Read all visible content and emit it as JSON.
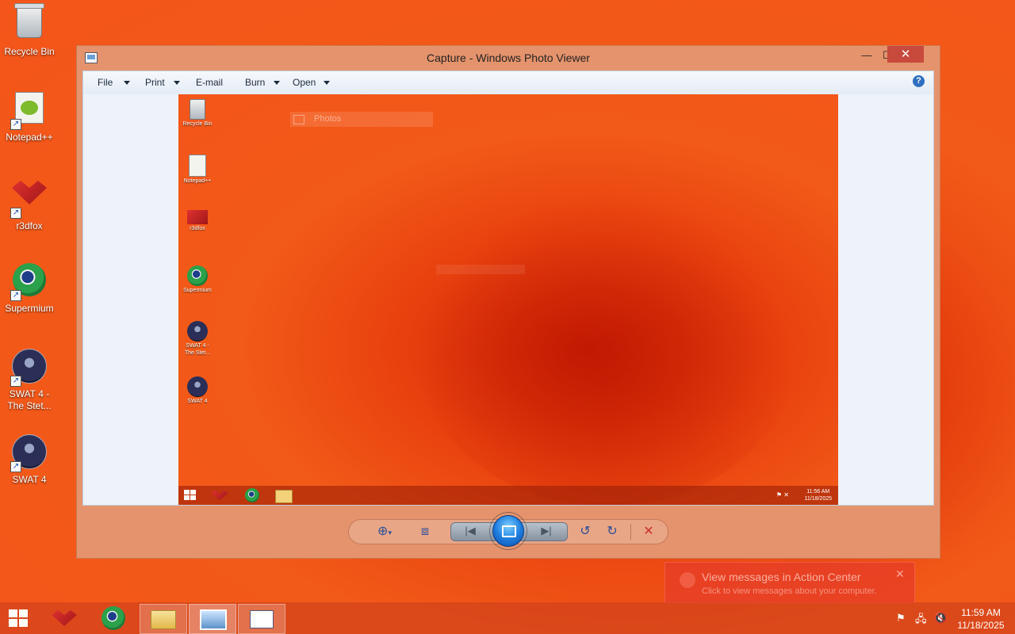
{
  "desktop": {
    "icons": [
      {
        "label": "Recycle Bin"
      },
      {
        "label": "Notepad++"
      },
      {
        "label": "r3dfox"
      },
      {
        "label": "Supermium"
      },
      {
        "label": "SWAT 4 - The Stet..."
      },
      {
        "label": "SWAT 4"
      }
    ]
  },
  "window": {
    "title": "Capture - Windows Photo Viewer",
    "controls": {
      "minimize": "—",
      "maximize": "☐",
      "close": "✕"
    }
  },
  "toolbar": {
    "file": "File",
    "print": "Print",
    "email": "E-mail",
    "burn": "Burn",
    "open": "Open",
    "help": "?"
  },
  "capture": {
    "icons": [
      {
        "label": "Recycle Bin"
      },
      {
        "label": "Notepad++"
      },
      {
        "label": "r3dfox"
      },
      {
        "label": "Supermium"
      },
      {
        "label": "SWAT 4 - The Stet..."
      },
      {
        "label": "SWAT 4"
      }
    ],
    "photos_label": "Photos",
    "time": "11:56 AM",
    "date": "11/18/2025"
  },
  "viewer_controls": {
    "zoom_icon": "zoom-icon",
    "fit_icon": "actual-size-icon",
    "prev_icon": "previous-icon",
    "slideshow_icon": "slideshow-icon",
    "next_icon": "next-icon",
    "rotate_ccw": "rotate-counterclockwise-icon",
    "rotate_cw": "rotate-clockwise-icon",
    "delete": "delete-icon"
  },
  "notification": {
    "title": "View messages in Action Center",
    "body": "Click to view messages about your computer."
  },
  "taskbar": {
    "time": "11:59 AM",
    "date": "11/18/2025"
  },
  "colors": {
    "wallpaper": "#f25a18",
    "window_frame": "#e5936c",
    "close_button": "#c74a3c"
  }
}
